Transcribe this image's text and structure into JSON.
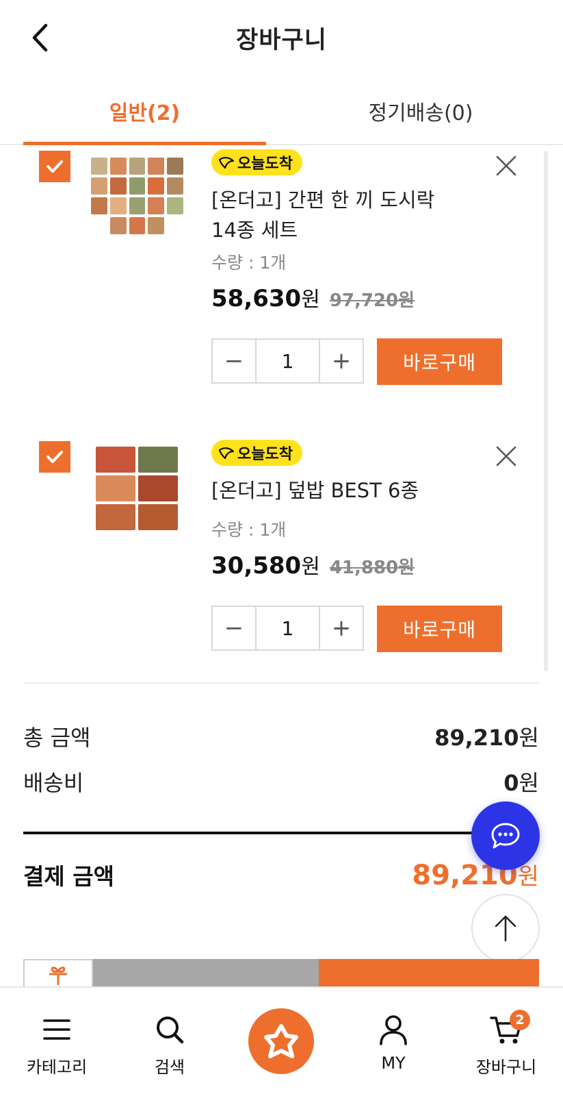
{
  "header": {
    "title": "장바구니"
  },
  "tabs": [
    {
      "label": "일반(2)",
      "active": true
    },
    {
      "label": "정기배송(0)",
      "active": false
    }
  ],
  "items": [
    {
      "badge": "오늘도착",
      "name_line1": "[온더고] 간편 한 끼 도시락",
      "name_line2": "14종 세트",
      "qty_label": "수량 : 1개",
      "price_sale": "58,630",
      "price_unit": "원",
      "price_orig": "97,720원",
      "qty": "1",
      "buy_label": "바로구매",
      "checked": true
    },
    {
      "badge": "오늘도착",
      "name_line1": "[온더고] 덮밥 BEST 6종",
      "qty_label": "수량 : 1개",
      "price_sale": "30,580",
      "price_unit": "원",
      "price_orig": "41,880원",
      "qty": "1",
      "buy_label": "바로구매",
      "checked": true
    }
  ],
  "summary": {
    "total_label": "총 금액",
    "total_value": "89,210",
    "shipping_label": "배송비",
    "shipping_value": "0",
    "won": "원",
    "pay_label": "결제 금액",
    "pay_value": "89,210"
  },
  "stepper": {
    "minus": "−",
    "plus": "+"
  },
  "nav": {
    "category": "카테고리",
    "search": "검색",
    "my": "MY",
    "cart": "장바구니",
    "cart_count": "2"
  },
  "colors": {
    "accent": "#ee6f2d",
    "badge": "#ffe11c",
    "chat": "#2d34e6"
  },
  "icons": [
    "back-icon",
    "check-icon",
    "close-icon",
    "chat-icon",
    "arrow-up-icon",
    "gift-icon",
    "menu-icon",
    "search-icon",
    "home-logo-icon",
    "user-icon",
    "cart-icon"
  ]
}
